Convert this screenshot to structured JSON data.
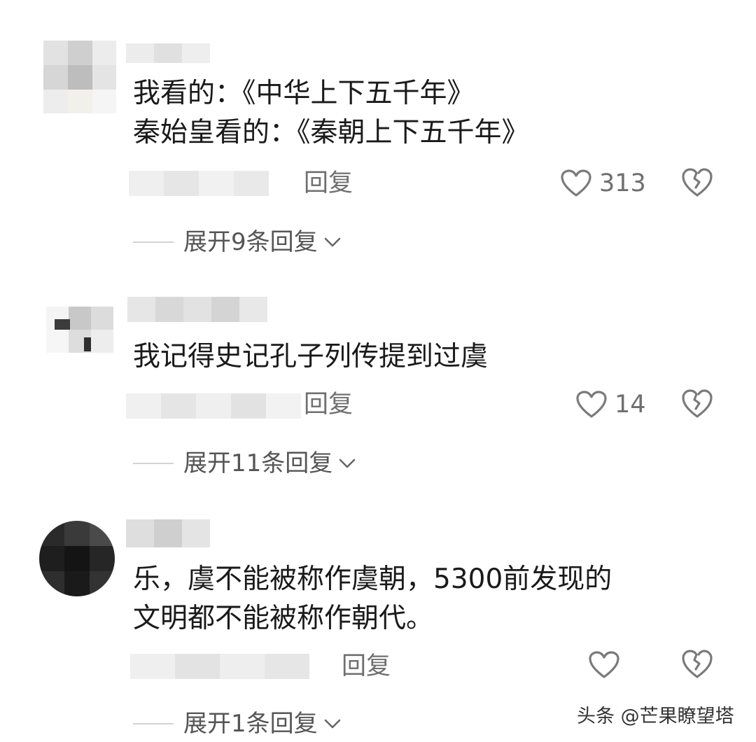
{
  "comments": [
    {
      "lines": [
        "我看的：《中华上下五千年》",
        "秦始皇看的：《秦朝上下五千年》"
      ],
      "reply_label": "回复",
      "like_count": "313",
      "expand_label": "展开9条回复"
    },
    {
      "lines": [
        "我记得史记孔子列传提到过虞"
      ],
      "reply_label": "回复",
      "like_count": "14",
      "expand_label": "展开11条回复"
    },
    {
      "lines": [
        "乐，虞不能被称作虞朝，5300前发现的",
        "文明都不能被称作朝代。"
      ],
      "reply_label": "回复",
      "like_count": "",
      "expand_label": "展开1条回复"
    }
  ],
  "watermark": "头条 @芒果瞭望塔",
  "colors": {
    "text": "#1a1a1a",
    "secondary": "#6f6f6f",
    "icon_stroke": "#7a7a7a"
  },
  "icons": {
    "like": "heart-outline-icon",
    "dislike": "broken-heart-icon",
    "expand": "chevron-down-icon"
  }
}
